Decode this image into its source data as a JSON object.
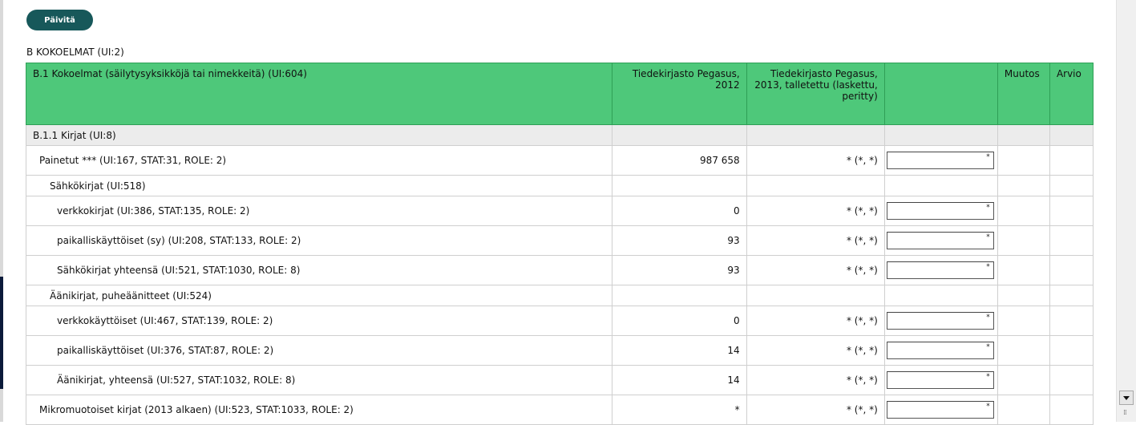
{
  "toolbar": {
    "refresh_label": "Päivitä"
  },
  "section": {
    "title": "B KOKOELMAT (UI:2)"
  },
  "table": {
    "headers": {
      "name": "B.1 Kokoelmat (säilytysyksikköjä tai nimekkeitä) (UI:604)",
      "col2012": "Tiedekirjasto Pegasus, 2012",
      "col2013": "Tiedekirjasto Pegasus, 2013, talletettu (laskettu, peritty)",
      "input": "",
      "change": "Muutos",
      "estimate": "Arvio"
    },
    "group": {
      "label": "B.1.1 Kirjat (UI:8)"
    },
    "rows": [
      {
        "label": "Painetut *** (UI:167, STAT:31, ROLE: 2)",
        "v2012": "987 658",
        "v2013": "* (*, *)",
        "mark": "*"
      },
      {
        "label": "Sähkökirjat (UI:518)",
        "v2012": "",
        "v2013": "",
        "mark": ""
      },
      {
        "label": "verkkokirjat (UI:386, STAT:135, ROLE: 2)",
        "v2012": "0",
        "v2013": "* (*, *)",
        "mark": "*"
      },
      {
        "label": "paikalliskäyttöiset (sy) (UI:208, STAT:133, ROLE: 2)",
        "v2012": "93",
        "v2013": "* (*, *)",
        "mark": "*"
      },
      {
        "label": "Sähkökirjat yhteensä (UI:521, STAT:1030, ROLE: 8)",
        "v2012": "93",
        "v2013": "* (*, *)",
        "mark": "*"
      },
      {
        "label": "Äänikirjat, puheäänitteet (UI:524)",
        "v2012": "",
        "v2013": "",
        "mark": ""
      },
      {
        "label": "verkkokäyttöiset (UI:467, STAT:139, ROLE: 2)",
        "v2012": "0",
        "v2013": "* (*, *)",
        "mark": "*"
      },
      {
        "label": "paikalliskäyttöiset (UI:376, STAT:87, ROLE: 2)",
        "v2012": "14",
        "v2013": "* (*, *)",
        "mark": "*"
      },
      {
        "label": "Äänikirjat, yhteensä (UI:527, STAT:1032, ROLE: 8)",
        "v2012": "14",
        "v2013": "* (*, *)",
        "mark": "*"
      },
      {
        "label": "Mikromuotoiset kirjat (2013 alkaen) (UI:523, STAT:1033, ROLE: 2)",
        "v2012": "*",
        "v2013": "* (*, *)",
        "mark": "*"
      }
    ]
  },
  "colors": {
    "header_green": "#4ec87a",
    "button_teal": "#17585a",
    "group_gray": "#ececec"
  }
}
